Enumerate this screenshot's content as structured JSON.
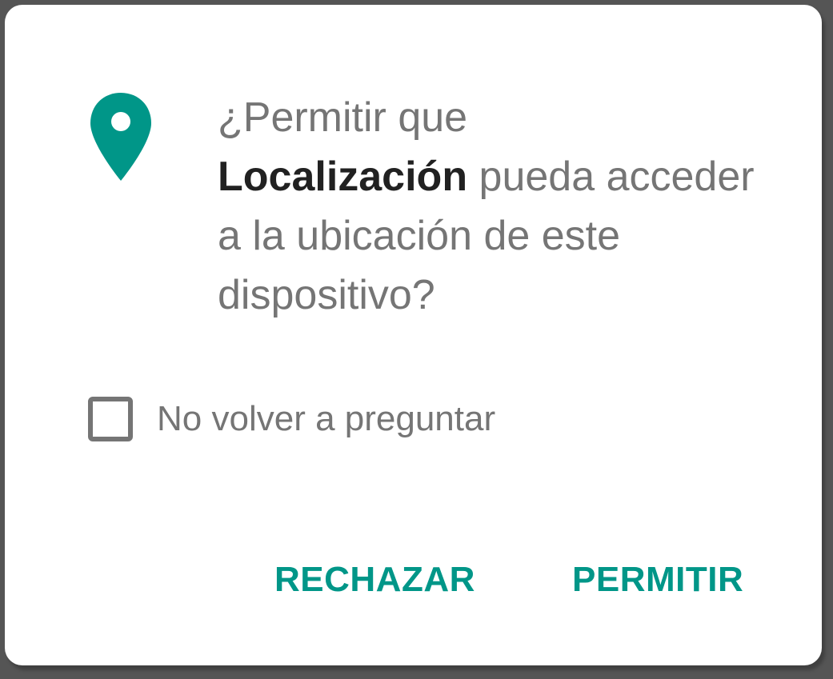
{
  "dialog": {
    "icon": "location-pin-icon",
    "accent_color": "#009688",
    "message_prefix": "¿Permitir que",
    "app_name": "Localización",
    "message_suffix": "pueda acceder a la ubicación de este dispositivo?",
    "checkbox": {
      "label": "No volver a preguntar",
      "checked": false
    },
    "buttons": {
      "deny": "RECHAZAR",
      "allow": "PERMITIR"
    }
  }
}
